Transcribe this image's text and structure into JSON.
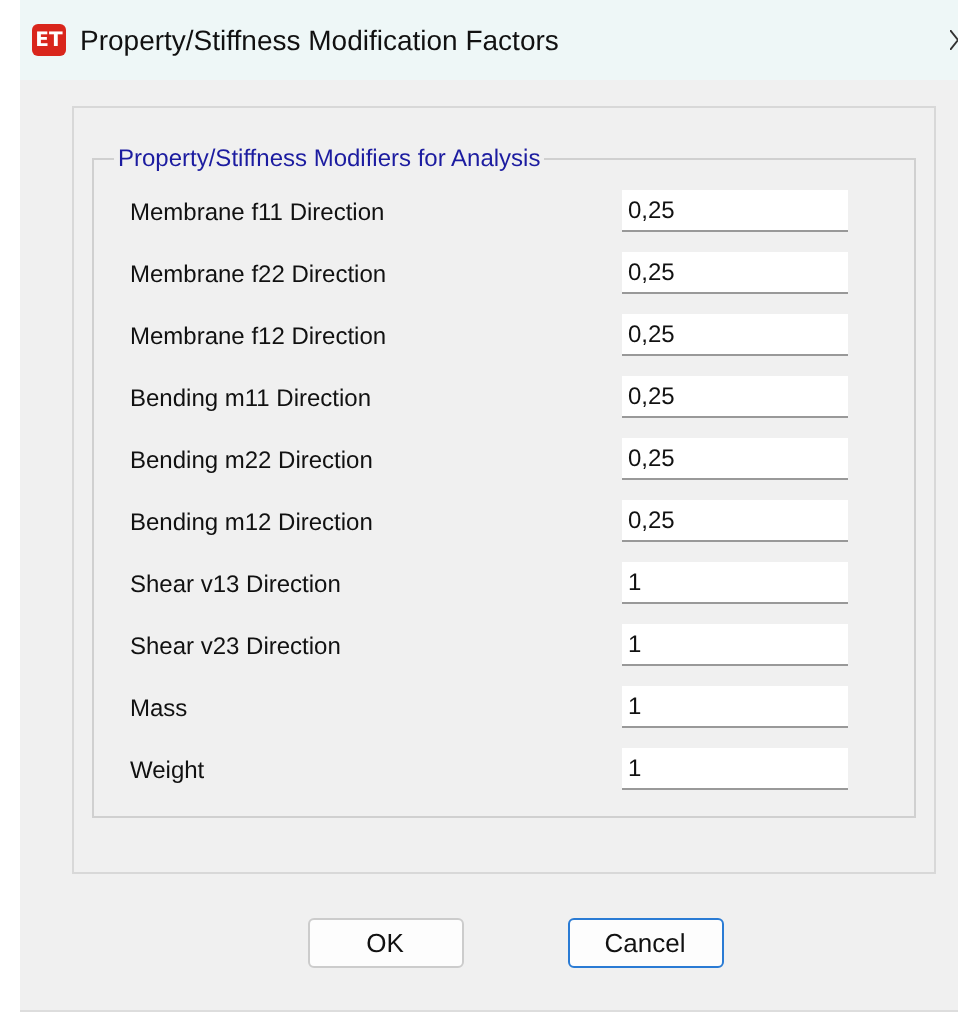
{
  "window": {
    "title": "Property/Stiffness Modification Factors",
    "app_badge": "ET"
  },
  "group": {
    "title": "Property/Stiffness Modifiers for Analysis",
    "fields": [
      {
        "label": "Membrane f11 Direction",
        "value": "0,25"
      },
      {
        "label": "Membrane f22 Direction",
        "value": "0,25"
      },
      {
        "label": "Membrane f12 Direction",
        "value": "0,25"
      },
      {
        "label": "Bending m11 Direction",
        "value": "0,25"
      },
      {
        "label": "Bending m22 Direction",
        "value": "0,25"
      },
      {
        "label": "Bending m12 Direction",
        "value": "0,25"
      },
      {
        "label": "Shear v13 Direction",
        "value": "1"
      },
      {
        "label": "Shear v23 Direction",
        "value": "1"
      },
      {
        "label": "Mass",
        "value": "1"
      },
      {
        "label": "Weight",
        "value": "1"
      }
    ]
  },
  "buttons": [
    {
      "label": "OK",
      "default": false
    },
    {
      "label": "Cancel",
      "default": true
    }
  ]
}
